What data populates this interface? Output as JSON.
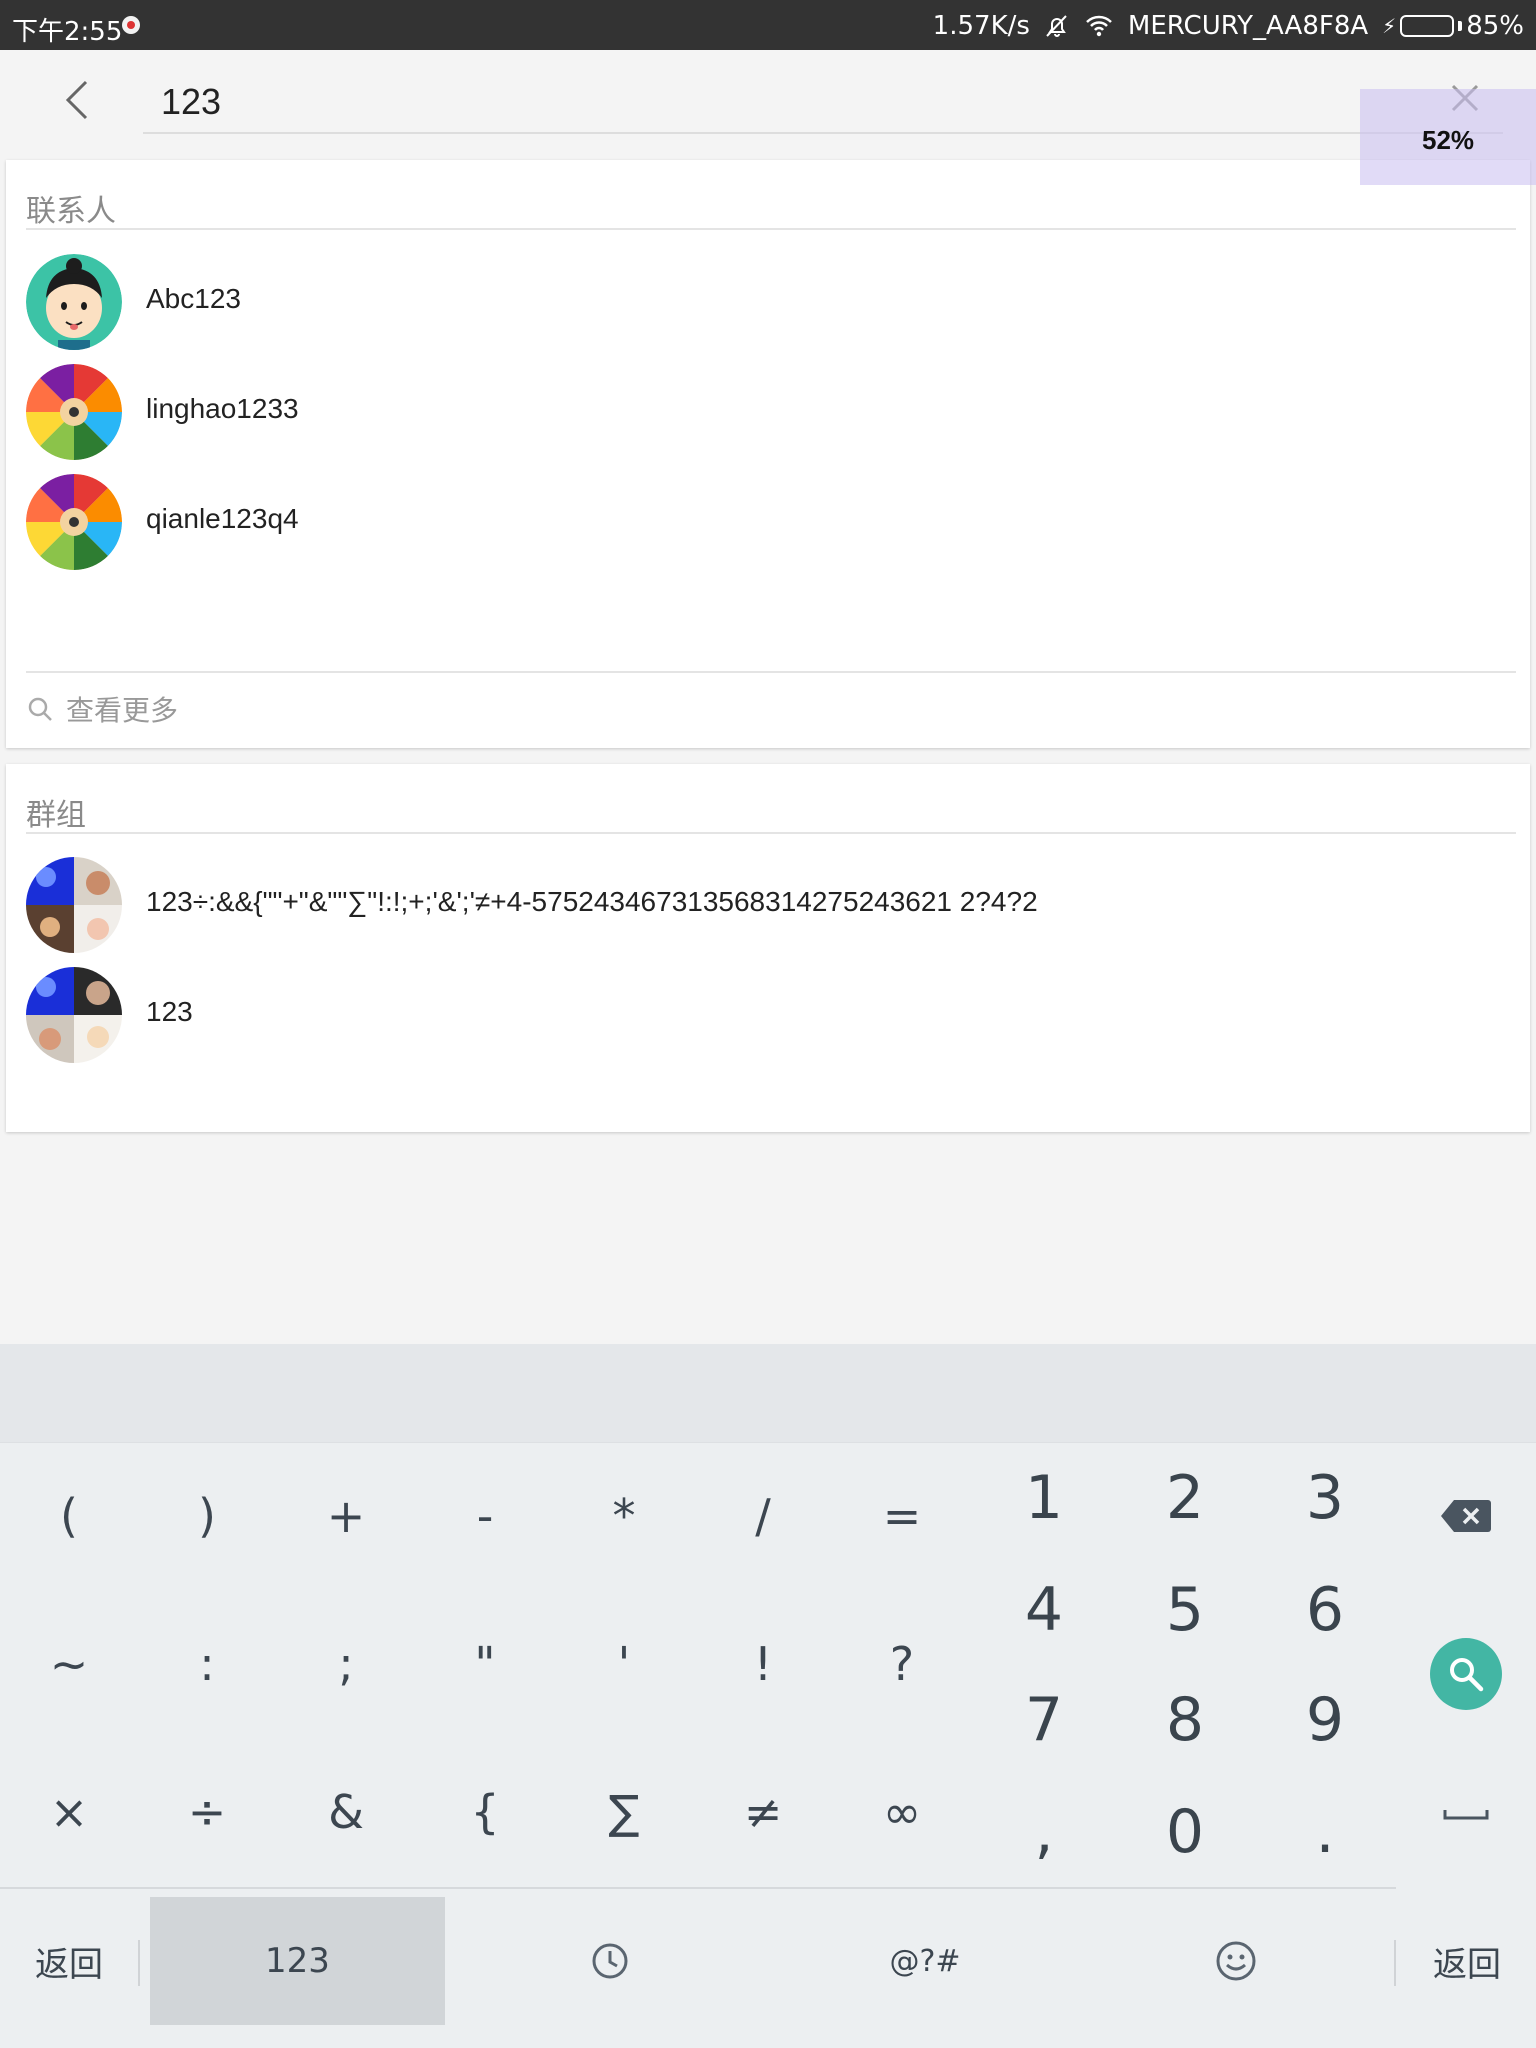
{
  "status_bar": {
    "time": "下午2:55",
    "net_speed": "1.57K/s",
    "ssid": "MERCURY_AA8F8A",
    "battery": "85%",
    "battery_level": 0.85,
    "battery_color": "#4cd137"
  },
  "search": {
    "query": "123",
    "zoom": "52%"
  },
  "contacts": {
    "title": "联系人",
    "items": [
      {
        "name": "Abc123",
        "avatar": "cartoon-boy"
      },
      {
        "name": "linghao1233",
        "avatar": "color-pencils"
      },
      {
        "name": "qianle123q4",
        "avatar": "color-pencils"
      }
    ],
    "see_more": "查看更多"
  },
  "groups": {
    "title": "群组",
    "items": [
      {
        "name": "123÷:&&{\"\"+\"&\"\"∑\"!:!;+;'&';'≠+4-575243467313568314275243621 2?4?2",
        "avatar": "group-collage"
      },
      {
        "name": "123",
        "avatar": "group-collage"
      }
    ]
  },
  "keyboard": {
    "symbols": [
      [
        "(",
        ")",
        "+",
        "-",
        "*",
        "/",
        "="
      ],
      [
        "~",
        ":",
        ";",
        "\"",
        "'",
        "!",
        "?"
      ],
      [
        "×",
        "÷",
        "&",
        "{",
        "∑",
        "≠",
        "∞"
      ]
    ],
    "numbers": [
      [
        "1",
        "2",
        "3"
      ],
      [
        "4",
        "5",
        "6"
      ],
      [
        "7",
        "8",
        "9"
      ],
      [
        ",",
        "0",
        "."
      ]
    ],
    "bottom": {
      "back_left": "返回",
      "mode_123": "123",
      "symbols": "@?#",
      "back_right": "返回"
    },
    "accent": "#43b6a4"
  }
}
